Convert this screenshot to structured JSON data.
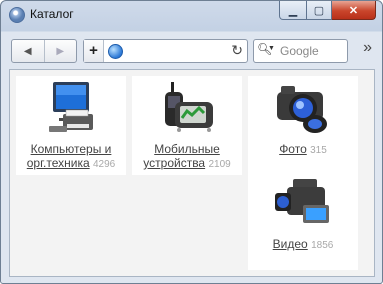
{
  "window": {
    "title": "Каталог"
  },
  "toolbar": {
    "search_placeholder": "Google"
  },
  "catalog": [
    {
      "line1": "Компьютеры и",
      "line2": "орг.техника",
      "count": "4296"
    },
    {
      "line1": "Мобильные",
      "line2": "устройства",
      "count": "2109"
    },
    {
      "line1": "Фото",
      "count": "315"
    },
    {
      "line1": "Видео",
      "count": "1856"
    }
  ]
}
